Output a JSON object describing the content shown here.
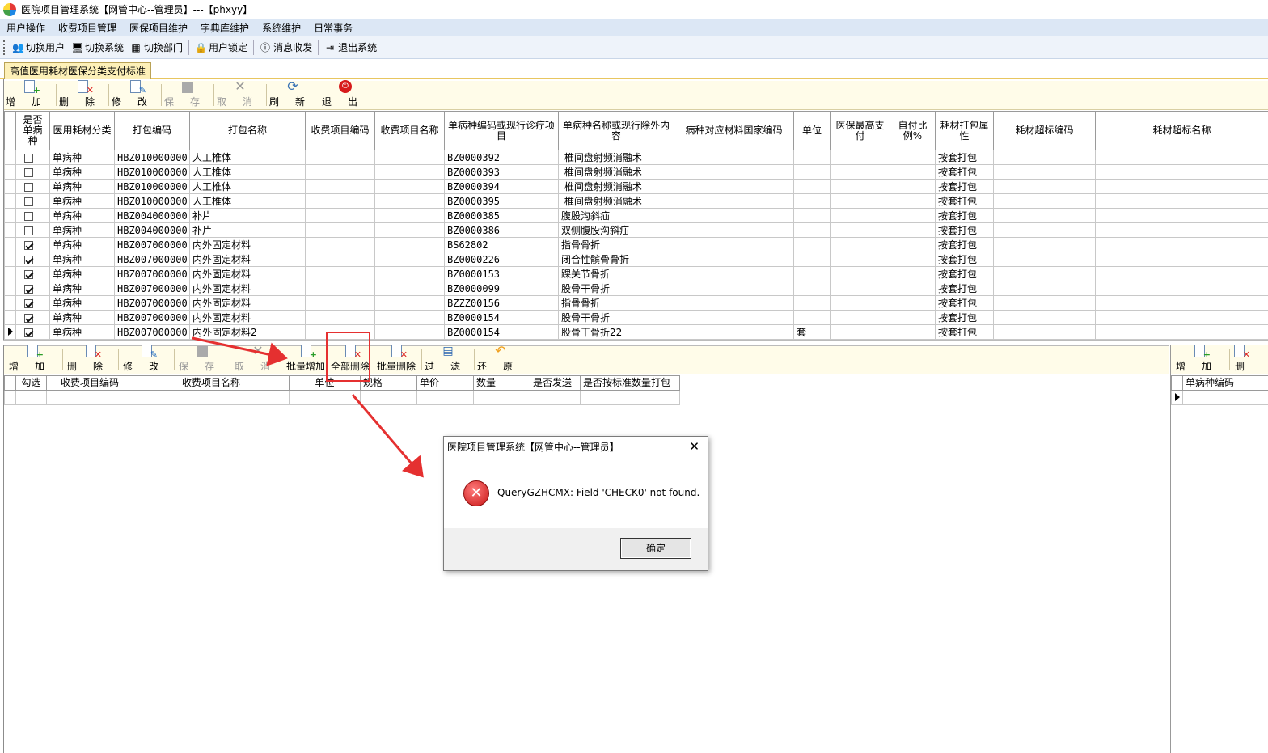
{
  "window": {
    "title": "医院项目管理系统【网管中心--管理员】---【phxyy】"
  },
  "menu": [
    "用户操作",
    "收费项目管理",
    "医保项目维护",
    "字典库维护",
    "系统维护",
    "日常事务"
  ],
  "quickbar": [
    {
      "label": "切换用户",
      "icon": "switch-user-icon"
    },
    {
      "label": "切换系统",
      "icon": "switch-system-icon"
    },
    {
      "label": "切换部门",
      "icon": "switch-department-icon"
    },
    {
      "label": "用户锁定",
      "icon": "user-lock-icon"
    },
    {
      "label": "消息收发",
      "icon": "message-icon"
    },
    {
      "label": "退出系统",
      "icon": "exit-system-icon"
    }
  ],
  "tab": {
    "label": "高值医用耗材医保分类支付标准"
  },
  "toolbar_top": [
    {
      "label": "增加",
      "icon": "add-icon",
      "enabled": true
    },
    {
      "label": "删除",
      "icon": "delete-icon",
      "enabled": true
    },
    {
      "label": "修改",
      "icon": "edit-icon",
      "enabled": true
    },
    {
      "label": "保存",
      "icon": "save-icon",
      "enabled": false
    },
    {
      "label": "取消",
      "icon": "cancel-icon",
      "enabled": false
    },
    {
      "label": "刷新",
      "icon": "refresh-icon",
      "enabled": true
    },
    {
      "label": "退出",
      "icon": "exit-icon",
      "enabled": true
    }
  ],
  "main_grid": {
    "columns": [
      "是否单病种",
      "医用耗材分类",
      "打包编码",
      "打包名称",
      "收费项目编码",
      "收费项目名称",
      "单病种编码或现行诊疗项目",
      "单病种名称或现行除外内容",
      "病种对应材料国家编码",
      "单位",
      "医保最高支付",
      "自付比例%",
      "耗材打包属性",
      "耗材超标编码",
      "耗材超标名称"
    ],
    "rows": [
      {
        "checked": false,
        "cat": "单病种",
        "code": "HBZ010000000",
        "name": "人工椎体",
        "dcode": "BZ0000392",
        "dname": " 椎间盘射频消融术",
        "unit": "",
        "attr": "按套打包"
      },
      {
        "checked": false,
        "cat": "单病种",
        "code": "HBZ010000000",
        "name": "人工椎体",
        "dcode": "BZ0000393",
        "dname": " 椎间盘射频消融术",
        "unit": "",
        "attr": "按套打包"
      },
      {
        "checked": false,
        "cat": "单病种",
        "code": "HBZ010000000",
        "name": "人工椎体",
        "dcode": "BZ0000394",
        "dname": " 椎间盘射频消融术",
        "unit": "",
        "attr": "按套打包"
      },
      {
        "checked": false,
        "cat": "单病种",
        "code": "HBZ010000000",
        "name": "人工椎体",
        "dcode": "BZ0000395",
        "dname": " 椎间盘射频消融术",
        "unit": "",
        "attr": "按套打包"
      },
      {
        "checked": false,
        "cat": "单病种",
        "code": "HBZ004000000",
        "name": "补片",
        "dcode": "BZ0000385",
        "dname": "腹股沟斜疝",
        "unit": "",
        "attr": "按套打包"
      },
      {
        "checked": false,
        "cat": "单病种",
        "code": "HBZ004000000",
        "name": "补片",
        "dcode": "BZ0000386",
        "dname": "双侧腹股沟斜疝",
        "unit": "",
        "attr": "按套打包"
      },
      {
        "checked": true,
        "cat": "单病种",
        "code": "HBZ007000000",
        "name": "内外固定材料",
        "dcode": "BS62802",
        "dname": "指骨骨折",
        "unit": "",
        "attr": "按套打包"
      },
      {
        "checked": true,
        "cat": "单病种",
        "code": "HBZ007000000",
        "name": "内外固定材料",
        "dcode": "BZ0000226",
        "dname": "闭合性髌骨骨折",
        "unit": "",
        "attr": "按套打包"
      },
      {
        "checked": true,
        "cat": "单病种",
        "code": "HBZ007000000",
        "name": "内外固定材料",
        "dcode": "BZ0000153",
        "dname": "踝关节骨折",
        "unit": "",
        "attr": "按套打包"
      },
      {
        "checked": true,
        "cat": "单病种",
        "code": "HBZ007000000",
        "name": "内外固定材料",
        "dcode": "BZ0000099",
        "dname": "股骨干骨折",
        "unit": "",
        "attr": "按套打包"
      },
      {
        "checked": true,
        "cat": "单病种",
        "code": "HBZ007000000",
        "name": "内外固定材料",
        "dcode": "BZZZ00156",
        "dname": "指骨骨折",
        "unit": "",
        "attr": "按套打包"
      },
      {
        "checked": true,
        "cat": "单病种",
        "code": "HBZ007000000",
        "name": "内外固定材料",
        "dcode": "BZ0000154",
        "dname": "股骨干骨折",
        "unit": "",
        "attr": "按套打包"
      },
      {
        "checked": true,
        "cat": "单病种",
        "code": "HBZ007000000",
        "name": "内外固定材料2",
        "dcode": "BZ0000154",
        "dname": "股骨干骨折22",
        "unit": "套",
        "attr": "按套打包",
        "current": true
      }
    ]
  },
  "toolbar_bottom": [
    {
      "label": "增加",
      "icon": "add-icon",
      "enabled": true
    },
    {
      "label": "删除",
      "icon": "delete-icon",
      "enabled": true
    },
    {
      "label": "修改",
      "icon": "edit-icon",
      "enabled": true
    },
    {
      "label": "保存",
      "icon": "save-icon",
      "enabled": false
    },
    {
      "label": "取消",
      "icon": "cancel-icon",
      "enabled": false
    },
    {
      "label": "批量增加",
      "icon": "batch-add-icon",
      "enabled": true
    },
    {
      "label": "全部删除",
      "icon": "delete-all-icon",
      "enabled": true
    },
    {
      "label": "批量删除",
      "icon": "batch-delete-icon",
      "enabled": true
    },
    {
      "label": "过滤",
      "icon": "filter-icon",
      "enabled": true
    },
    {
      "label": "还原",
      "icon": "restore-icon",
      "enabled": true
    }
  ],
  "detail_grid": {
    "columns": [
      "勾选",
      "收费项目编码",
      "收费项目名称",
      "单位",
      "规格",
      "单价",
      "数量",
      "是否发送",
      "是否按标准数量打包"
    ]
  },
  "right_toolbar": [
    {
      "label": "增加",
      "icon": "add-icon"
    },
    {
      "label": "删",
      "icon": "delete-icon"
    }
  ],
  "right_grid": {
    "columns": [
      "单病种编码"
    ]
  },
  "dialog": {
    "title": "医院项目管理系统【网管中心--管理员】",
    "message": "QueryGZHCMX: Field 'CHECK0' not found.",
    "ok_label": "确定",
    "close_glyph": "✕",
    "error_glyph": "✕"
  },
  "colors": {
    "highlight": "#e53030",
    "toolbar_bg": "#fffce9",
    "menu_bg": "#dce7f5"
  }
}
